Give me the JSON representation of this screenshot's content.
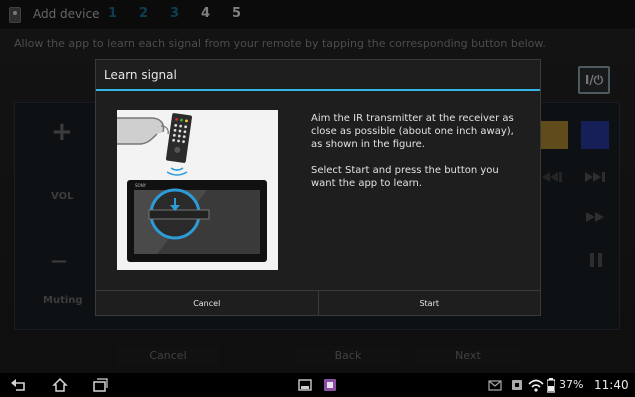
{
  "header": {
    "title": "Add device",
    "steps": [
      "1",
      "2",
      "3",
      "4",
      "5"
    ]
  },
  "instruction": "Allow the app to learn each signal from your remote by tapping the corresponding button below.",
  "remote": {
    "plus": "+",
    "vol": "VOL",
    "minus": "—",
    "muting": "Muting",
    "power": "I/⏻",
    "swatches": [
      "#b08a31",
      "#283aa0"
    ]
  },
  "bottom_buttons": {
    "cancel": "Cancel",
    "back": "Back",
    "next": "Next"
  },
  "dialog": {
    "title": "Learn signal",
    "text1": "Aim the IR transmitter at the receiver as close as possible (about one inch away), as shown in the figure.",
    "text2": "Select Start and press the button you want the app to learn.",
    "cancel": "Cancel",
    "start": "Start",
    "figure_brand": "SONY"
  },
  "statusbar": {
    "battery": "37%",
    "time": "11:40"
  },
  "icons": {
    "back": "back-icon",
    "home": "home-icon",
    "recent": "recent-apps-icon"
  }
}
